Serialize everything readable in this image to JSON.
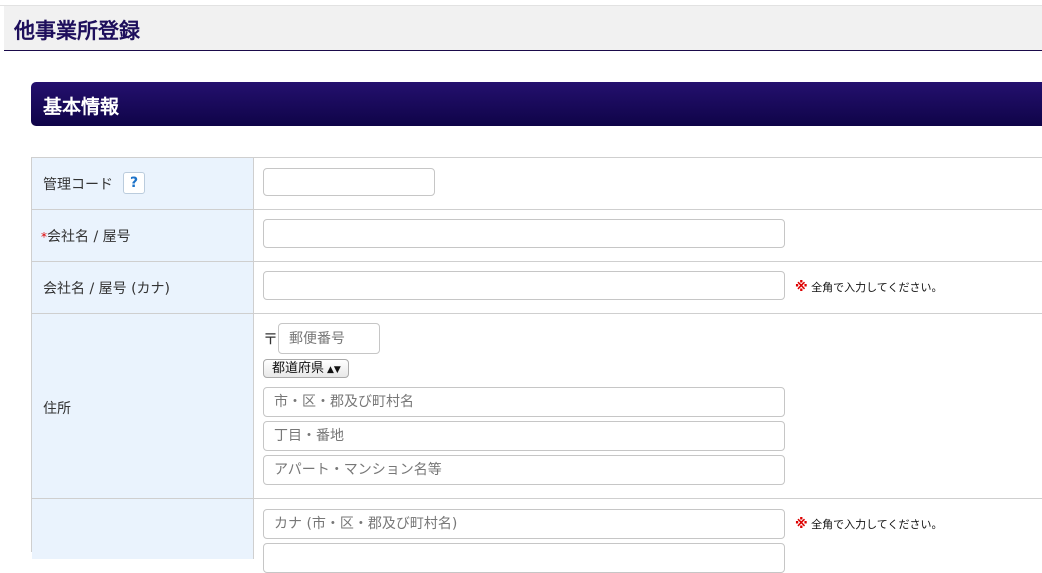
{
  "page": {
    "title": "他事業所登録"
  },
  "section": {
    "title": "基本情報"
  },
  "help_icon": "?",
  "required_mark": "*",
  "fields": {
    "management_code": {
      "label": "管理コード",
      "value": ""
    },
    "company_name": {
      "label": "会社名 / 屋号",
      "value": ""
    },
    "company_name_kana": {
      "label": "会社名 / 屋号 (カナ)",
      "value": "",
      "note_mark": "※",
      "note": "全角で入力してください。"
    },
    "address": {
      "label": "住所",
      "postal_mark": "〒",
      "postal_placeholder": "郵便番号",
      "prefecture_selected": "都道府県",
      "city_placeholder": "市・区・郡及び町村名",
      "street_placeholder": "丁目・番地",
      "building_placeholder": "アパート・マンション名等"
    },
    "address_kana": {
      "city_placeholder": "カナ (市・区・郡及び町村名)",
      "note_mark": "※",
      "note": "全角で入力してください。"
    }
  }
}
